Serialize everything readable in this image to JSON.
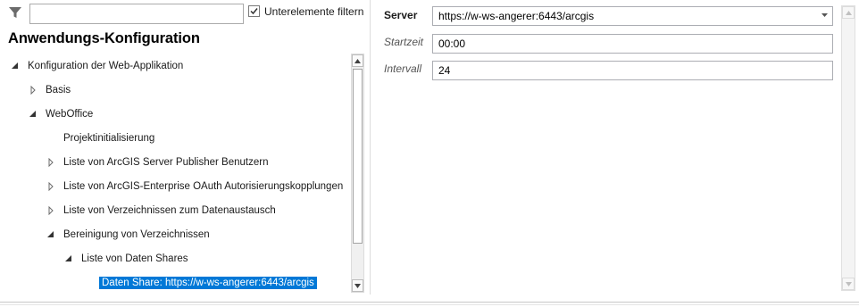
{
  "filter": {
    "search_value": "",
    "subfilter_label": "Unterelemente filtern",
    "subfilter_checked": true
  },
  "panel": {
    "title": "Anwendungs-Konfiguration"
  },
  "tree": {
    "items": [
      {
        "label": "Konfiguration der Web-Applikation",
        "state": "expanded",
        "level": 0
      },
      {
        "label": "Basis",
        "state": "collapsed",
        "level": 1
      },
      {
        "label": "WebOffice",
        "state": "expanded",
        "level": 1
      },
      {
        "label": "Projektinitialisierung",
        "state": "leaf",
        "level": 2
      },
      {
        "label": "Liste von ArcGIS Server Publisher Benutzern",
        "state": "collapsed",
        "level": 2
      },
      {
        "label": "Liste von ArcGIS-Enterprise OAuth Autorisierungskopplungen",
        "state": "collapsed",
        "level": 2
      },
      {
        "label": "Liste von Verzeichnissen zum Datenaustausch",
        "state": "collapsed",
        "level": 2
      },
      {
        "label": "Bereinigung von Verzeichnissen",
        "state": "expanded",
        "level": 2
      },
      {
        "label": "Liste von Daten Shares",
        "state": "expanded",
        "level": 3
      },
      {
        "label": "Daten Share: https://w-ws-angerer:6443/arcgis",
        "state": "leaf",
        "level": 4,
        "selected": true
      }
    ]
  },
  "properties": {
    "server_label": "Server",
    "server_value": "https://w-ws-angerer:6443/arcgis",
    "startzeit_label": "Startzeit",
    "startzeit_value": "00:00",
    "intervall_label": "Intervall",
    "intervall_value": "24"
  },
  "colors": {
    "selection": "#0078d7",
    "border": "#abadb3"
  },
  "icons": [
    "filter-icon",
    "checkbox-check-icon",
    "tree-expanded-icon",
    "tree-collapsed-icon",
    "scroll-up-icon",
    "scroll-down-icon",
    "dropdown-arrow-icon"
  ]
}
